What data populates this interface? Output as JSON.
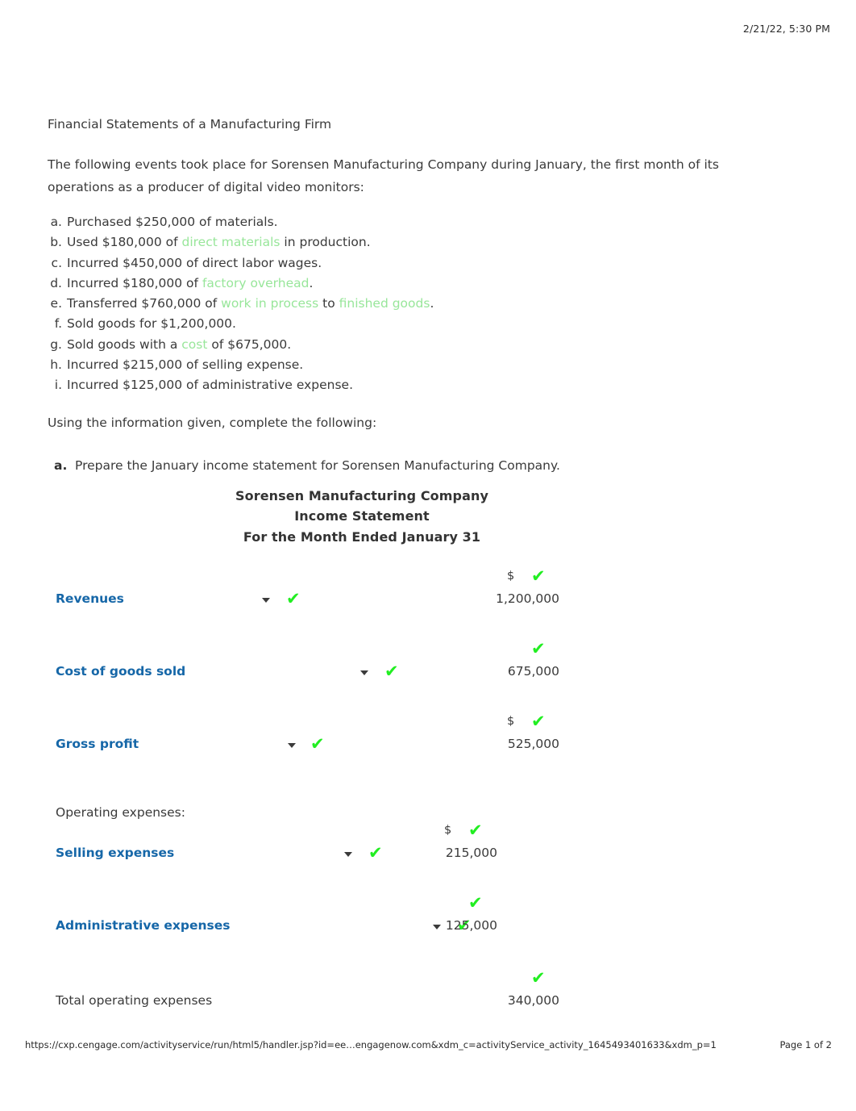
{
  "header": {
    "timestamp": "2/21/22, 5:30 PM"
  },
  "footer": {
    "url": "https://cxp.cengage.com/activityservice/run/html5/handler.jsp?id=ee…engagenow.com&xdm_c=activityService_activity_1645493401633&xdm_p=1",
    "page_label": "Page 1 of 2"
  },
  "colors": {
    "label_blue": "#1667a8",
    "check_green": "#22ee22",
    "term_green": "#98e69a",
    "body_gray": "#3a3a3a"
  },
  "document": {
    "title": "Financial Statements of a Manufacturing Firm",
    "intro": "The following events took place for Sorensen Manufacturing Company during January, the first month of its operations as a producer of digital video monitors:",
    "events": [
      {
        "marker": "a.",
        "parts": [
          {
            "text": "Purchased $250,000 of materials.",
            "style": "plain"
          }
        ]
      },
      {
        "marker": "b.",
        "parts": [
          {
            "text": "Used $180,000 of ",
            "style": "plain"
          },
          {
            "text": "direct materials",
            "style": "term"
          },
          {
            "text": " in production.",
            "style": "plain"
          }
        ]
      },
      {
        "marker": "c.",
        "parts": [
          {
            "text": "Incurred $450,000 of direct labor wages.",
            "style": "plain"
          }
        ]
      },
      {
        "marker": "d.",
        "parts": [
          {
            "text": "Incurred $180,000 of ",
            "style": "plain"
          },
          {
            "text": "factory overhead",
            "style": "term"
          },
          {
            "text": ".",
            "style": "plain"
          }
        ]
      },
      {
        "marker": "e.",
        "parts": [
          {
            "text": "Transferred $760,000 of ",
            "style": "plain"
          },
          {
            "text": "work in process",
            "style": "term"
          },
          {
            "text": " to ",
            "style": "plain"
          },
          {
            "text": "finished goods",
            "style": "term"
          },
          {
            "text": ".",
            "style": "plain"
          }
        ]
      },
      {
        "marker": "f.",
        "parts": [
          {
            "text": "Sold goods for $1,200,000.",
            "style": "plain"
          }
        ]
      },
      {
        "marker": "g.",
        "parts": [
          {
            "text": "Sold goods with a ",
            "style": "plain"
          },
          {
            "text": "cost",
            "style": "term"
          },
          {
            "text": " of $675,000.",
            "style": "plain"
          }
        ]
      },
      {
        "marker": "h.",
        "parts": [
          {
            "text": "Incurred $215,000 of selling expense.",
            "style": "plain"
          }
        ]
      },
      {
        "marker": "i.",
        "parts": [
          {
            "text": "Incurred $125,000 of administrative expense.",
            "style": "plain"
          }
        ]
      }
    ],
    "using_line": "Using the information given, complete the following:"
  },
  "requirement": {
    "letter": "a.",
    "text": "Prepare the January income statement for Sorensen Manufacturing Company."
  },
  "statement": {
    "title_line1": "Sorensen Manufacturing Company",
    "title_line2": "Income Statement",
    "title_line3": "For the Month Ended January 31",
    "rows": [
      {
        "label": "Revenues",
        "label_style": "dropdown",
        "dollar": "$",
        "amount": "1,200,000",
        "amount_column": "main",
        "label_checked": true,
        "amount_checked": true
      },
      {
        "label": "Cost of goods sold",
        "label_style": "dropdown",
        "dollar": "",
        "amount": "675,000",
        "amount_column": "main",
        "label_checked": true,
        "amount_checked": true
      },
      {
        "label": "Gross profit",
        "label_style": "dropdown",
        "dollar": "$",
        "amount": "525,000",
        "amount_column": "main",
        "label_checked": true,
        "amount_checked": true
      },
      {
        "label": "Operating expenses:",
        "label_style": "plain",
        "dollar": "",
        "amount": "",
        "amount_column": "none",
        "label_checked": false,
        "amount_checked": false
      },
      {
        "label": "Selling expenses",
        "label_style": "dropdown",
        "dollar": "$",
        "amount": "215,000",
        "amount_column": "indent",
        "label_checked": true,
        "amount_checked": true
      },
      {
        "label": "Administrative expenses",
        "label_style": "dropdown",
        "dollar": "",
        "amount": "125,000",
        "amount_column": "indent",
        "label_checked": true,
        "amount_checked": true
      },
      {
        "label": "Total operating expenses",
        "label_style": "plain",
        "dollar": "",
        "amount": "340,000",
        "amount_column": "main",
        "label_checked": false,
        "amount_checked": true
      }
    ]
  },
  "icons": {
    "caret": "chevron-down-icon",
    "check": "check-mark-icon"
  }
}
